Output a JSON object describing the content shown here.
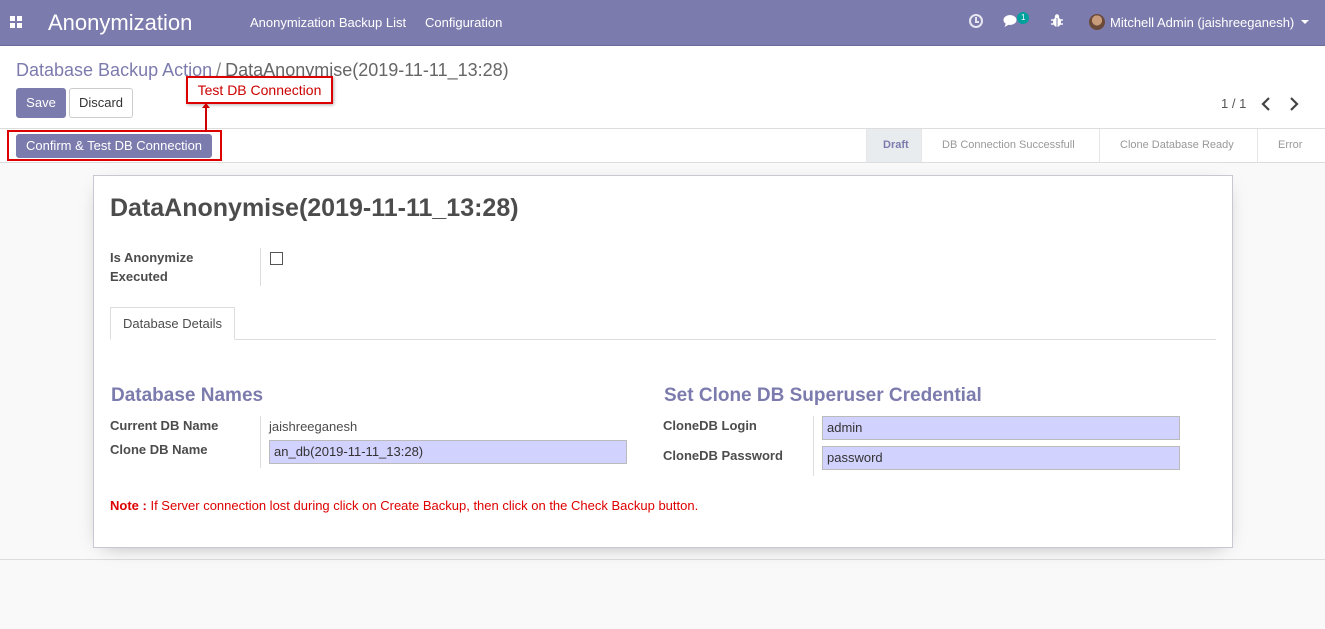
{
  "navbar": {
    "brand": "Anonymization",
    "menu": [
      "Anonymization Backup List",
      "Configuration"
    ],
    "chat_count": "1",
    "user": "Mitchell Admin (jaishreeganesh)",
    "icons": [
      "apps-icon",
      "clock-icon",
      "chat-icon",
      "bug-icon",
      "avatar",
      "caret-down-icon"
    ]
  },
  "breadcrumb": {
    "parent": "Database Backup Action",
    "separator": "/",
    "current": "DataAnonymise(2019-11-11_13:28)"
  },
  "buttons": {
    "save": "Save",
    "discard": "Discard",
    "confirm": "Confirm & Test DB Connection"
  },
  "pager": {
    "value": "1 / 1"
  },
  "callout": {
    "label": "Test DB Connection"
  },
  "stages": [
    {
      "label": "Draft",
      "active": true
    },
    {
      "label": "DB Connection Successfull",
      "active": false
    },
    {
      "label": "Clone Database Ready",
      "active": false
    },
    {
      "label": "Error",
      "active": false
    }
  ],
  "form": {
    "title": "DataAnonymise(2019-11-11_13:28)",
    "is_anonymize_label_1": "Is Anonymize",
    "is_anonymize_label_2": "Executed",
    "is_anonymize_checked": false,
    "tab": "Database Details",
    "left_group": {
      "title": "Database Names",
      "current_db_label": "Current DB Name",
      "current_db_value": "jaishreeganesh",
      "clone_db_label": "Clone DB Name",
      "clone_db_value": "an_db(2019-11-11_13:28)"
    },
    "right_group": {
      "title": "Set Clone DB Superuser Credential",
      "login_label": "CloneDB Login",
      "login_value": "admin",
      "password_label": "CloneDB Password",
      "password_value": "password"
    },
    "note_prefix": "Note :",
    "note_text": " If Server connection lost during click on Create Backup, then click on the Check Backup button."
  },
  "colors": {
    "brand": "#7c7bad",
    "input_bg": "#d2d2ff",
    "note": "#dd0000",
    "callout_border": "#dd0000"
  }
}
